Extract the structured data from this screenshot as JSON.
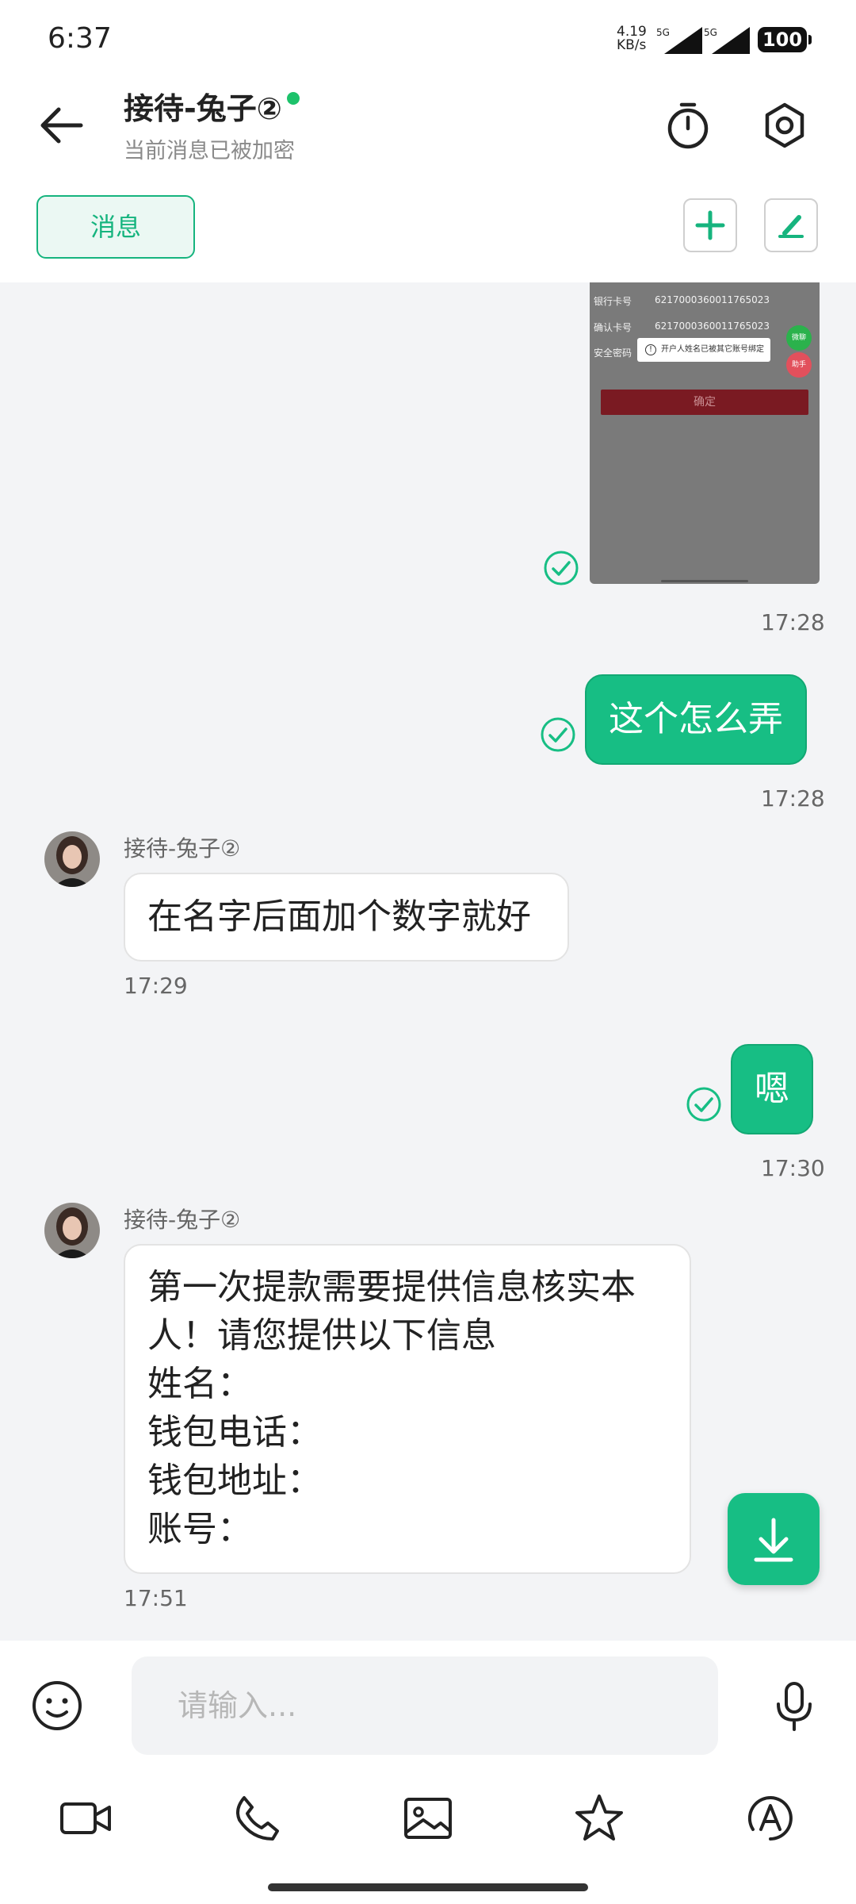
{
  "status_bar": {
    "time": "6:37",
    "speed_value": "4.19",
    "speed_unit": "KB/s",
    "network_1": "5G",
    "network_2": "5G",
    "battery": "100"
  },
  "header": {
    "title": "接待-兔子②",
    "subtitle": "当前消息已被加密",
    "online_color": "#1dc26b"
  },
  "tabs": {
    "messages_label": "消息"
  },
  "screenshot_card": {
    "rows": [
      {
        "label": "银行卡号",
        "value": "6217000360011765023"
      },
      {
        "label": "确认卡号",
        "value": "6217000360011765023"
      },
      {
        "label": "安全密码",
        "value": ""
      }
    ],
    "alert": "开户人姓名已被其它账号绑定",
    "confirm": "确定",
    "pill_green": "微聊",
    "pill_red": "助手",
    "time": "17:28"
  },
  "messages": [
    {
      "direction": "out",
      "text": "这个怎么弄",
      "time": "17:28"
    },
    {
      "direction": "in",
      "sender": "接待-兔子②",
      "text": "在名字后面加个数字就好",
      "time": "17:29"
    },
    {
      "direction": "out",
      "text": "嗯",
      "time": "17:30"
    },
    {
      "direction": "in",
      "sender": "接待-兔子②",
      "lines": [
        "第一次提款需要提供信息核实本",
        "人！请您提供以下信息",
        "姓名：",
        "钱包电话：",
        "钱包地址：",
        "账号："
      ],
      "time": "17:51"
    }
  ],
  "input": {
    "placeholder": "请输入..."
  },
  "colors": {
    "accent": "#17be84",
    "background": "#f3f4f6"
  },
  "icons": {
    "back": "arrow-left-icon",
    "timer": "timer-icon",
    "settings": "hexagon-settings-icon",
    "add": "plus-icon",
    "edit": "pencil-icon",
    "download": "download-icon",
    "emoji": "smiley-icon",
    "mic": "microphone-icon",
    "video": "video-camera-icon",
    "phone": "phone-icon",
    "image": "image-icon",
    "star": "star-icon",
    "translate": "translate-icon"
  }
}
